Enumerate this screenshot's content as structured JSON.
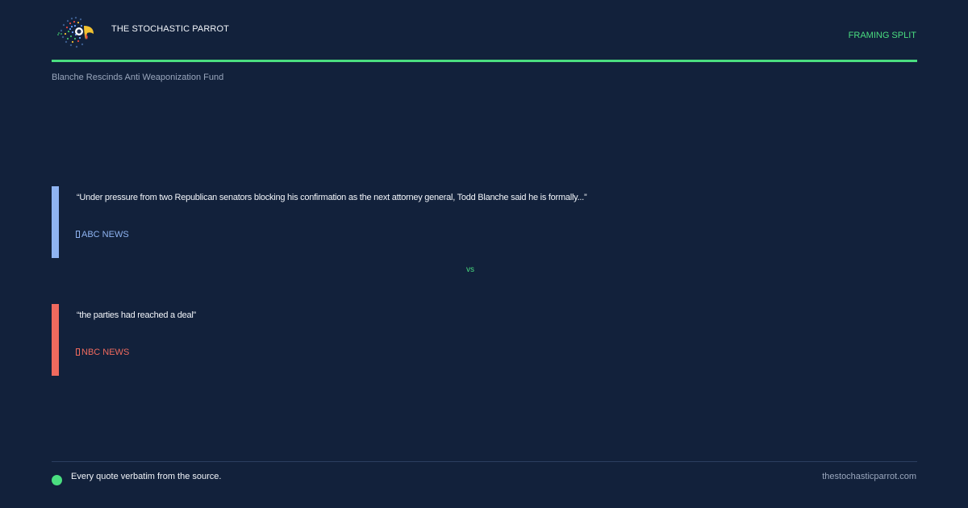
{
  "header": {
    "brand": "THE STOCHASTIC PARROT",
    "logo_icon": "parrot-logo-icon",
    "tag": "FRAMING SPLIT"
  },
  "headline": "Blanche Rescinds Anti Weaponization Fund",
  "quotes": [
    {
      "text": "“Under pressure from two Republican senators blocking his confirmation as the next attorney general, Todd Blanche said he is formally...”",
      "source": "ABC NEWS",
      "accent": "#8fb4f2"
    },
    {
      "text": "“the parties had reached a deal”",
      "source": "NBC NEWS",
      "accent": "#ef6a5e"
    }
  ],
  "vs_label": "vs",
  "footer": {
    "note": "Every quote verbatim from the source.",
    "site": "thestochasticparrot.com"
  },
  "colors": {
    "background": "#12213b",
    "accent": "#4ade80"
  }
}
